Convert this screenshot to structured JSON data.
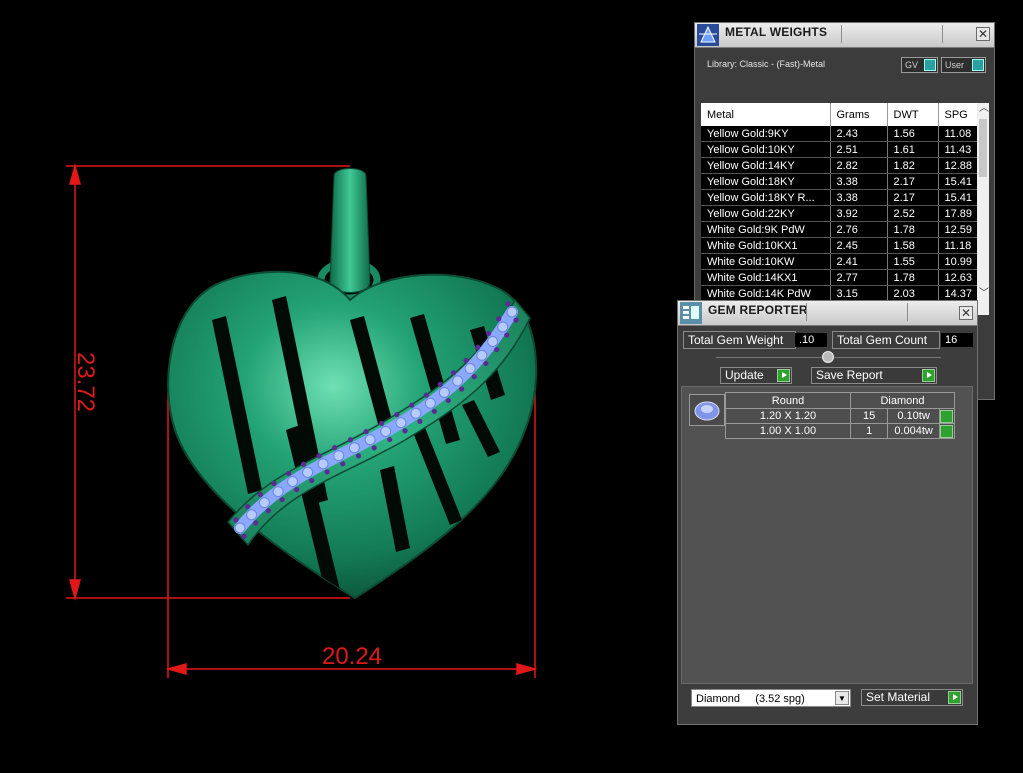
{
  "viewport": {
    "height_dim": "23.72",
    "width_dim": "20.24",
    "colors": {
      "dimension": "#e01818",
      "metal": "#1a8a62",
      "gems": "#9fb8ff",
      "prongs": "#5a2a8a"
    }
  },
  "metal_weights": {
    "title": "METAL WEIGHTS",
    "library_label": "Library: Classic - (Fast)-Metal",
    "toggle_gv": "GV",
    "toggle_user": "User",
    "columns": [
      "Metal",
      "Grams",
      "DWT",
      "SPG"
    ],
    "rows": [
      {
        "metal": "Yellow Gold:9KY",
        "grams": "2.43",
        "dwt": "1.56",
        "spg": "11.08"
      },
      {
        "metal": "Yellow Gold:10KY",
        "grams": "2.51",
        "dwt": "1.61",
        "spg": "11.43"
      },
      {
        "metal": "Yellow Gold:14KY",
        "grams": "2.82",
        "dwt": "1.82",
        "spg": "12.88"
      },
      {
        "metal": "Yellow Gold:18KY",
        "grams": "3.38",
        "dwt": "2.17",
        "spg": "15.41"
      },
      {
        "metal": "Yellow Gold:18KY R...",
        "grams": "3.38",
        "dwt": "2.17",
        "spg": "15.41"
      },
      {
        "metal": "Yellow Gold:22KY",
        "grams": "3.92",
        "dwt": "2.52",
        "spg": "17.89"
      },
      {
        "metal": "White Gold:9K PdW",
        "grams": "2.76",
        "dwt": "1.78",
        "spg": "12.59"
      },
      {
        "metal": "White Gold:10KX1",
        "grams": "2.45",
        "dwt": "1.58",
        "spg": "11.18"
      },
      {
        "metal": "White Gold:10KW",
        "grams": "2.41",
        "dwt": "1.55",
        "spg": "10.99"
      },
      {
        "metal": "White Gold:14KX1",
        "grams": "2.77",
        "dwt": "1.78",
        "spg": "12.63"
      },
      {
        "metal": "White Gold:14K PdW",
        "grams": "3.15",
        "dwt": "2.03",
        "spg": "14.37"
      }
    ]
  },
  "gem_reporter": {
    "title": "GEM REPORTER",
    "total_weight_label": "Total Gem Weight",
    "total_weight_value": ".10",
    "total_count_label": "Total Gem Count",
    "total_count_value": "16",
    "update_label": "Update",
    "save_report_label": "Save Report",
    "table_header_shape": "Round",
    "table_header_material": "Diamond",
    "gems": [
      {
        "size": "1.20 X 1.20",
        "count": "15",
        "weight": "0.10tw"
      },
      {
        "size": "1.00 X 1.00",
        "count": "1",
        "weight": "0.004tw"
      }
    ],
    "material_select": "Diamond     (3.52 spg)",
    "set_material_label": "Set Material"
  }
}
